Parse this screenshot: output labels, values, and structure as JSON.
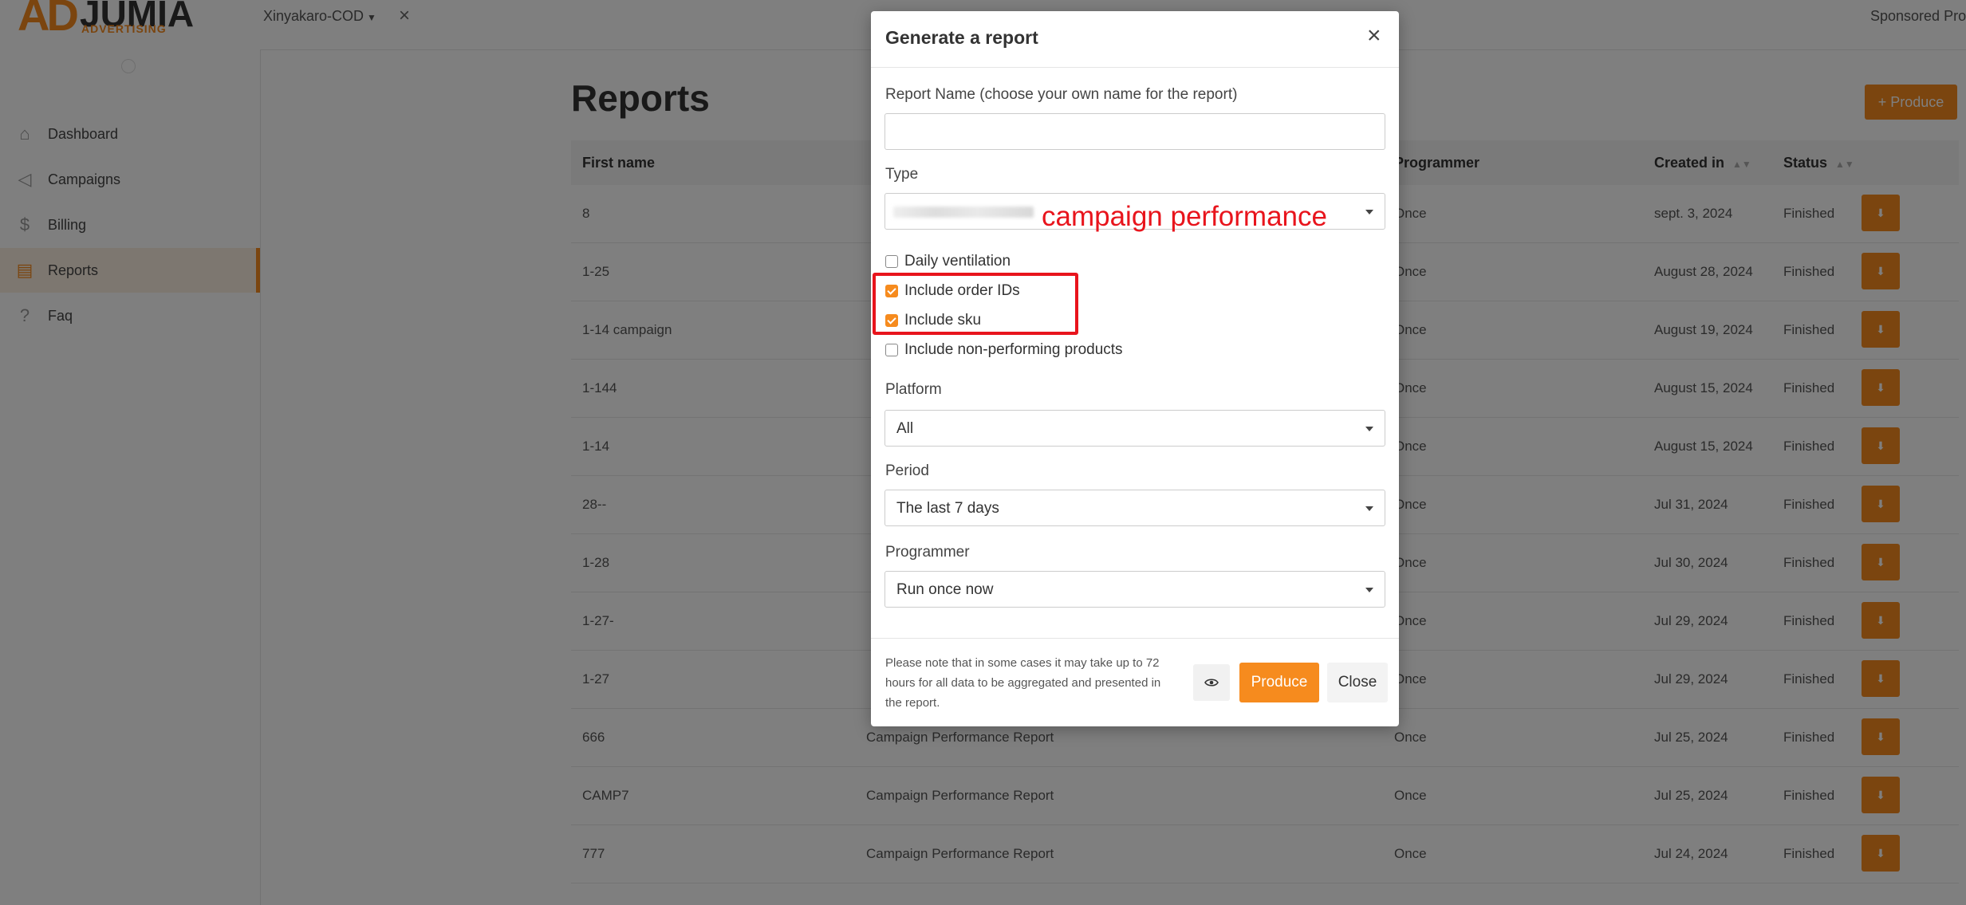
{
  "app": {
    "logo_mark": "AD",
    "logo_word": "JUMIA",
    "logo_sub": "ADVERTISING",
    "account": "Xinyakaro-COD",
    "top_right": "Sponsored Pro"
  },
  "sidebar": {
    "items": [
      {
        "label": "Dashboard",
        "icon": "home-icon"
      },
      {
        "label": "Campaigns",
        "icon": "megaphone-icon"
      },
      {
        "label": "Billing",
        "icon": "dollar-icon"
      },
      {
        "label": "Reports",
        "icon": "report-icon"
      },
      {
        "label": "Faq",
        "icon": "question-icon"
      }
    ],
    "active_index": 3
  },
  "main": {
    "title": "Reports",
    "produce_button": "+ Produce",
    "columns": [
      "First name",
      "Programmer",
      "Created in",
      "Status"
    ],
    "rows": [
      {
        "name": "8",
        "type": "",
        "programmer": "Once",
        "created": "sept. 3, 2024",
        "status": "Finished"
      },
      {
        "name": "1-25",
        "type": "",
        "programmer": "Once",
        "created": "August 28, 2024",
        "status": "Finished"
      },
      {
        "name": "1-14 campaign",
        "type": "",
        "programmer": "Once",
        "created": "August 19, 2024",
        "status": "Finished"
      },
      {
        "name": "1-144",
        "type": "",
        "programmer": "Once",
        "created": "August 15, 2024",
        "status": "Finished"
      },
      {
        "name": "1-14",
        "type": "",
        "programmer": "Once",
        "created": "August 15, 2024",
        "status": "Finished"
      },
      {
        "name": "28--",
        "type": "",
        "programmer": "Once",
        "created": "Jul 31, 2024",
        "status": "Finished"
      },
      {
        "name": "1-28",
        "type": "",
        "programmer": "Once",
        "created": "Jul 30, 2024",
        "status": "Finished"
      },
      {
        "name": "1-27-",
        "type": "",
        "programmer": "Once",
        "created": "Jul 29, 2024",
        "status": "Finished"
      },
      {
        "name": "1-27",
        "type": "",
        "programmer": "Once",
        "created": "Jul 29, 2024",
        "status": "Finished"
      },
      {
        "name": "666",
        "type": "Campaign Performance Report",
        "programmer": "Once",
        "created": "Jul 25, 2024",
        "status": "Finished"
      },
      {
        "name": "CAMP7",
        "type": "Campaign Performance Report",
        "programmer": "Once",
        "created": "Jul 25, 2024",
        "status": "Finished"
      },
      {
        "name": "777",
        "type": "Campaign Performance Report",
        "programmer": "Once",
        "created": "Jul 24, 2024",
        "status": "Finished"
      }
    ]
  },
  "modal": {
    "title": "Generate a report",
    "report_name_label": "Report Name (choose your own name for the report)",
    "report_name_value": "",
    "type_label": "Type",
    "type_annotation": "campaign performance",
    "checkboxes": [
      {
        "label": "Daily ventilation",
        "checked": false
      },
      {
        "label": "Include order IDs",
        "checked": true
      },
      {
        "label": "Include sku",
        "checked": true
      },
      {
        "label": "Include non-performing products",
        "checked": false
      }
    ],
    "platform_label": "Platform",
    "platform_value": "All",
    "period_label": "Period",
    "period_value": "The last 7 days",
    "programmer_label": "Programmer",
    "programmer_value": "Run once now",
    "note": "Please note that in some cases it may take up to 72 hours for all data to be aggregated and presented in the report.",
    "produce_label": "Produce",
    "close_label": "Close"
  },
  "colors": {
    "accent": "#f68b1e",
    "annotation": "#e8141c"
  }
}
